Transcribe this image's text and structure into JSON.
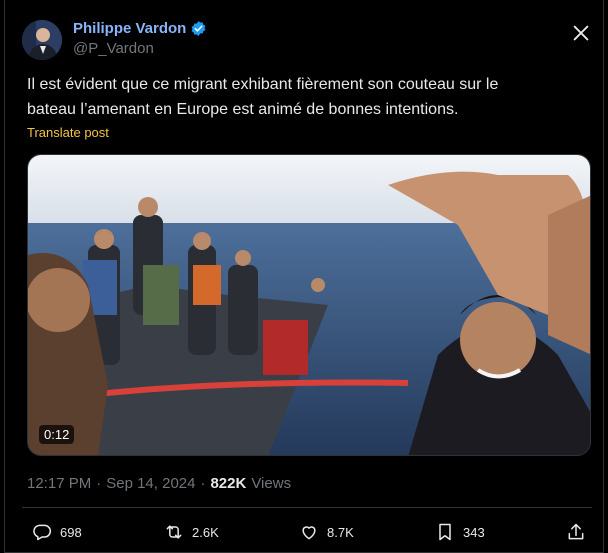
{
  "author": {
    "name": "Philippe Vardon",
    "handle": "@P_Vardon",
    "verified": true
  },
  "post": {
    "text_line1": "Il est évident que ce migrant exhibant fièrement son couteau sur le",
    "text_line2": "bateau l’amenant en Europe est animé de bonnes intentions.",
    "translate_label": "Translate post"
  },
  "video": {
    "duration": "0:12"
  },
  "meta": {
    "time": "12:17 PM",
    "separator": "·",
    "date": "Sep 14, 2024",
    "views_count": "822K",
    "views_label": "Views"
  },
  "actions": {
    "replies": "698",
    "reposts": "2.6K",
    "likes": "8.7K",
    "bookmarks": "343"
  },
  "colors": {
    "background": "#000000",
    "name": "#8ab4f8",
    "verified": "#1d9bf0",
    "translate": "#f4c542",
    "muted": "#71767b"
  },
  "icons": {
    "verified": "verified-badge-icon",
    "close": "close-icon",
    "reply": "reply-icon",
    "repost": "repost-icon",
    "like": "heart-icon",
    "bookmark": "bookmark-icon",
    "share": "share-icon"
  }
}
